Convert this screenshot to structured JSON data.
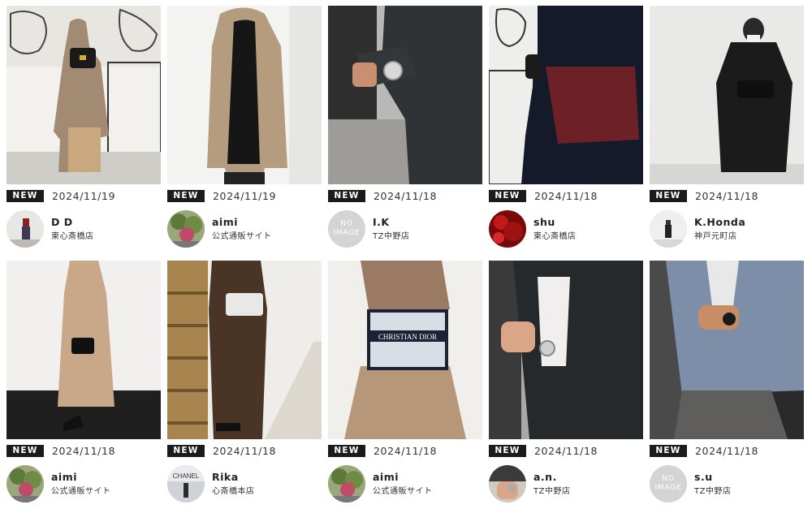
{
  "grid": {
    "cards": [
      {
        "badge": "NEW",
        "date": "2024/11/19",
        "user": "D D",
        "store": "東心斎橋店",
        "avatar": "photo"
      },
      {
        "badge": "NEW",
        "date": "2024/11/19",
        "user": "aimi",
        "store": "公式通販サイト",
        "avatar": "photo"
      },
      {
        "badge": "NEW",
        "date": "2024/11/18",
        "user": "I.K",
        "store": "TZ中野店",
        "avatar": "noimage",
        "noimage_line1": "NO",
        "noimage_line2": "IMAGE"
      },
      {
        "badge": "NEW",
        "date": "2024/11/18",
        "user": "shu",
        "store": "東心斎橋店",
        "avatar": "photo"
      },
      {
        "badge": "NEW",
        "date": "2024/11/18",
        "user": "K.Honda",
        "store": "神戸元町店",
        "avatar": "photo"
      },
      {
        "badge": "NEW",
        "date": "2024/11/18",
        "user": "aimi",
        "store": "公式通販サイト",
        "avatar": "photo"
      },
      {
        "badge": "NEW",
        "date": "2024/11/18",
        "user": "Rika",
        "store": "心斎橋本店",
        "avatar": "photo",
        "avatar_text": "CHANEL"
      },
      {
        "badge": "NEW",
        "date": "2024/11/18",
        "user": "aimi",
        "store": "公式通販サイト",
        "avatar": "photo"
      },
      {
        "badge": "NEW",
        "date": "2024/11/18",
        "user": "a.n.",
        "store": "TZ中野店",
        "avatar": "photo"
      },
      {
        "badge": "NEW",
        "date": "2024/11/18",
        "user": "s.u",
        "store": "TZ中野店",
        "avatar": "noimage",
        "noimage_line1": "NO",
        "noimage_line2": "IMAGE"
      }
    ]
  },
  "photos": {
    "p8_bag_text": "CHRISTIAN DIOR"
  }
}
